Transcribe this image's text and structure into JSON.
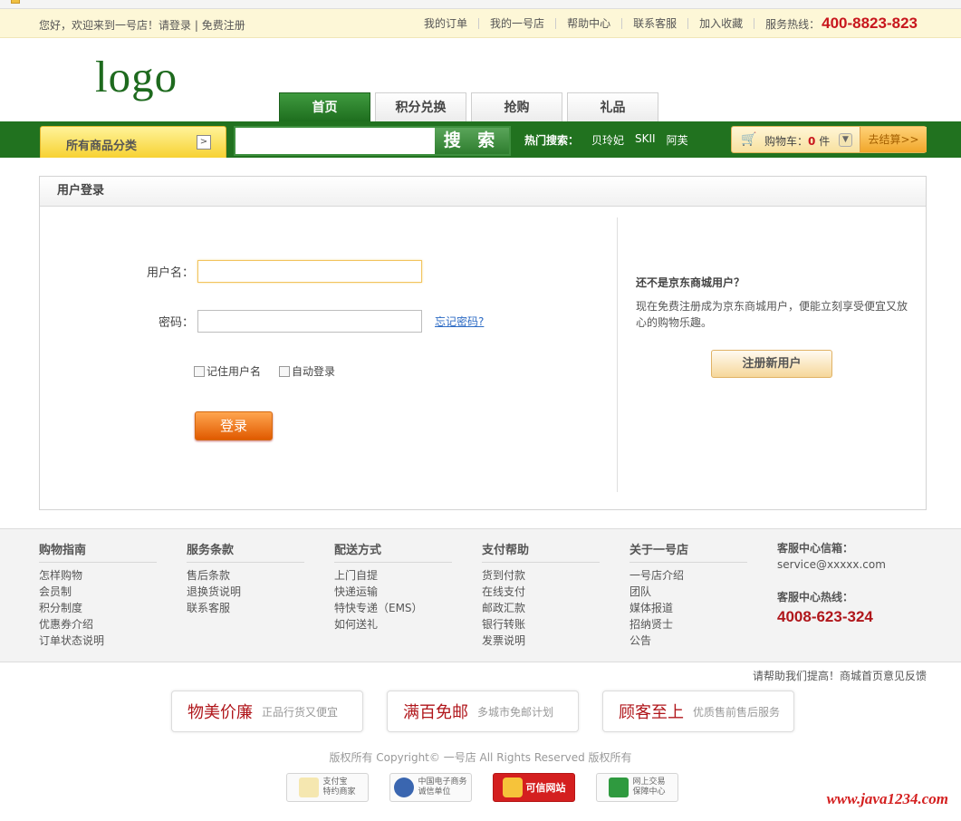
{
  "topbar": {
    "greeting": "您好，欢迎来到一号店！",
    "login": "请登录",
    "sep": "|",
    "register": "免费注册",
    "links": [
      "我的订单",
      "我的一号店",
      "帮助中心",
      "联系客服",
      "加入收藏"
    ],
    "hotline_label": "服务热线：",
    "hotline": "400-8823-823"
  },
  "logo": "logo",
  "nav": {
    "tabs": [
      "首页",
      "积分兑换",
      "抢购",
      "礼品"
    ],
    "active": 0
  },
  "category": {
    "label": "所有商品分类",
    "arrow": ">"
  },
  "search": {
    "button": "搜 索",
    "placeholder": ""
  },
  "hot": {
    "label": "热门搜索：",
    "keywords": [
      "贝玲妃",
      "SKII",
      "阿芙"
    ]
  },
  "cart": {
    "label": "购物车：",
    "count": "0",
    "unit": "件",
    "checkout": "去结算>>"
  },
  "login": {
    "panel_title": "用户登录",
    "username_label": "用户名：",
    "password_label": "密码：",
    "forgot": "忘记密码?",
    "remember": "记住用户名",
    "auto": "自动登录",
    "submit": "登录"
  },
  "register": {
    "title": "还不是京东商城用户？",
    "desc": "现在免费注册成为京东商城用户，便能立刻享受便宜又放心的购物乐趣。",
    "button": "注册新用户"
  },
  "footer": {
    "columns": [
      {
        "title": "购物指南",
        "links": [
          "怎样购物",
          "会员制",
          "积分制度",
          "优惠券介绍",
          "订单状态说明"
        ]
      },
      {
        "title": "服务条款",
        "links": [
          "售后条款",
          "退换货说明",
          "联系客服"
        ]
      },
      {
        "title": "配送方式",
        "links": [
          "上门自提",
          "快递运输",
          "特快专递（EMS）",
          "如何送礼"
        ]
      },
      {
        "title": "支付帮助",
        "links": [
          "货到付款",
          "在线支付",
          "邮政汇款",
          "银行转账",
          "发票说明"
        ]
      },
      {
        "title": "关于一号店",
        "links": [
          "一号店介绍",
          "团队",
          "媒体报道",
          "招纳贤士",
          "公告"
        ]
      }
    ],
    "service": {
      "email_label": "客服中心信箱：",
      "email": "service@xxxxx.com",
      "phone_label": "客服中心热线：",
      "phone": "4008-623-324"
    }
  },
  "feedback": "请帮助我们提高！商城首页意见反馈",
  "guarantees": [
    {
      "title": "物美价廉",
      "sub": "正品行货又便宜"
    },
    {
      "title": "满百免邮",
      "sub": "多城市免邮计划"
    },
    {
      "title": "顾客至上",
      "sub": "优质售前售后服务"
    }
  ],
  "copyright": "版权所有 Copyright© 一号店 All Rights Reserved 版权所有",
  "badges": [
    {
      "l1": "支付宝",
      "l2": "特约商家"
    },
    {
      "l1": "中国电子商务",
      "l2": "诚信单位"
    },
    {
      "l1": "可信网站",
      "l2": ""
    },
    {
      "l1": "网上交易",
      "l2": "保障中心"
    }
  ],
  "watermark": "www.java1234.com"
}
